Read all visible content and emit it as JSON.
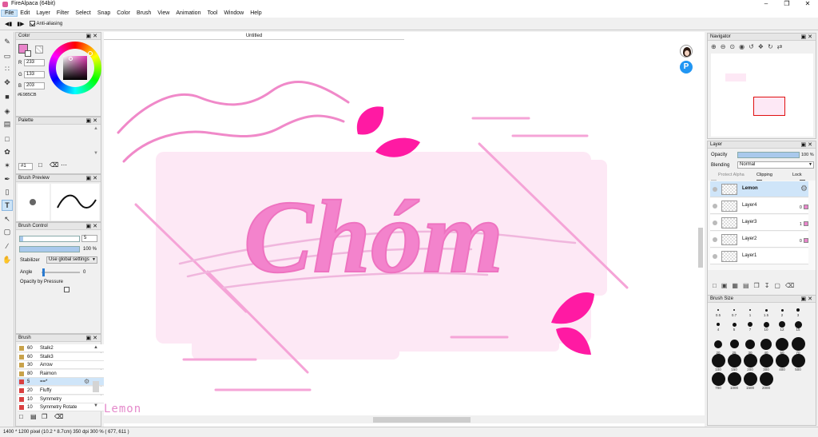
{
  "window": {
    "title": "FireAlpaca (64bit)"
  },
  "menu": [
    "File",
    "Edit",
    "Layer",
    "Filter",
    "Select",
    "Snap",
    "Color",
    "Brush",
    "View",
    "Animation",
    "Tool",
    "Window",
    "Help"
  ],
  "tool_options": {
    "anti_aliasing_label": "Anti-aliasing"
  },
  "color_panel": {
    "title": "Color",
    "r_label": "R",
    "r": "233",
    "g_label": "G",
    "g": "133",
    "b_label": "B",
    "b": "203",
    "hex": "#E985CB",
    "current_color": "#E985CB"
  },
  "palette_panel": {
    "title": "Palette",
    "selector": "#1"
  },
  "brush_preview_panel": {
    "title": "Brush Preview"
  },
  "brush_control_panel": {
    "title": "Brush Control",
    "size": "5",
    "opacity": "100 %",
    "stabilizer_label": "Stabilizer",
    "stabilizer_value": "Use global settings",
    "angle_label": "Angle",
    "angle_value": "0",
    "opacity_pressure_label": "Opacity by Pressure"
  },
  "brush_panel": {
    "title": "Brush",
    "items": [
      {
        "size": "60",
        "name": "Stalk2",
        "color": "#c8a24a"
      },
      {
        "size": "60",
        "name": "Stalk3",
        "color": "#c8a24a"
      },
      {
        "size": "30",
        "name": "Arrow",
        "color": "#c8a24a"
      },
      {
        "size": "80",
        "name": "Raimon",
        "color": "#c8a24a"
      },
      {
        "size": "5",
        "name": "==*",
        "color": "#d94040",
        "selected": true
      },
      {
        "size": "20",
        "name": "Fluffy",
        "color": "#d94040"
      },
      {
        "size": "10",
        "name": "Symmetry",
        "color": "#d94040"
      },
      {
        "size": "10",
        "name": "Symmetry Rotate",
        "color": "#d94040"
      }
    ]
  },
  "canvas": {
    "tab_title": "Untitled",
    "artwork_text": "Chóm",
    "watermark": "Lemon"
  },
  "navigator_panel": {
    "title": "Navigator"
  },
  "layer_panel": {
    "title": "Layer",
    "opacity_label": "Opacity",
    "opacity": "100 %",
    "blending_label": "Blending",
    "blending_value": "Normal",
    "protect_alpha_label": "Protect Alpha",
    "clipping_label": "Clipping",
    "lock_label": "Lock",
    "layers": [
      {
        "name": "Lemon",
        "selected": true
      },
      {
        "name": "Layer4",
        "badge": "0"
      },
      {
        "name": "Layer3",
        "badge": "1"
      },
      {
        "name": "Layer2",
        "badge": "0"
      },
      {
        "name": "Layer1"
      }
    ]
  },
  "brush_size_panel": {
    "title": "Brush Size",
    "rows": [
      [
        "0.5",
        "0.7",
        "1",
        "1.5",
        "2",
        "3"
      ],
      [
        "4",
        "5",
        "7",
        "10",
        "12",
        "15"
      ],
      [
        "20",
        "25",
        "30",
        "40",
        "50",
        "70"
      ],
      [
        "100",
        "150",
        "200",
        "300",
        "400",
        "500"
      ],
      [
        "700",
        "1000",
        "1500",
        "2000"
      ]
    ]
  },
  "status": {
    "text": "1400 * 1200 pixel   (10.2 * 8.7cm)   350 dpi   300 %   ( 677, 611 )"
  }
}
